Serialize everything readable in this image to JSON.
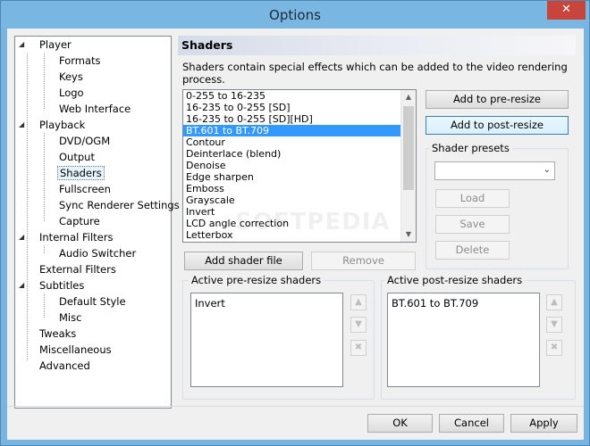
{
  "window": {
    "title": "Options",
    "close_glyph": "✕"
  },
  "tree": {
    "items": [
      {
        "label": "Player",
        "level": 0,
        "expandable": true
      },
      {
        "label": "Formats",
        "level": 1
      },
      {
        "label": "Keys",
        "level": 1
      },
      {
        "label": "Logo",
        "level": 1
      },
      {
        "label": "Web Interface",
        "level": 1
      },
      {
        "label": "Playback",
        "level": 0,
        "expandable": true
      },
      {
        "label": "DVD/OGM",
        "level": 1
      },
      {
        "label": "Output",
        "level": 1
      },
      {
        "label": "Shaders",
        "level": 1,
        "selected": true
      },
      {
        "label": "Fullscreen",
        "level": 1
      },
      {
        "label": "Sync Renderer Settings",
        "level": 1
      },
      {
        "label": "Capture",
        "level": 1
      },
      {
        "label": "Internal Filters",
        "level": 0,
        "expandable": true
      },
      {
        "label": "Audio Switcher",
        "level": 1
      },
      {
        "label": "External Filters",
        "level": 0
      },
      {
        "label": "Subtitles",
        "level": 0,
        "expandable": true
      },
      {
        "label": "Default Style",
        "level": 1
      },
      {
        "label": "Misc",
        "level": 1
      },
      {
        "label": "Tweaks",
        "level": 0
      },
      {
        "label": "Miscellaneous",
        "level": 0
      },
      {
        "label": "Advanced",
        "level": 0
      }
    ]
  },
  "page": {
    "title": "Shaders",
    "description": "Shaders contain special effects which can be added to the video rendering process."
  },
  "shader_list": {
    "items": [
      "0-255 to 16-235",
      "16-235 to 0-255 [SD]",
      "16-235 to 0-255 [SD][HD]",
      "BT.601 to BT.709",
      "Contour",
      "Deinterlace (blend)",
      "Denoise",
      "Edge sharpen",
      "Emboss",
      "Grayscale",
      "Invert",
      "LCD angle correction",
      "Letterbox"
    ],
    "selected_index": 3
  },
  "buttons": {
    "add_pre_resize": "Add to pre-resize",
    "add_post_resize": "Add to post-resize",
    "add_shader_file": "Add shader file",
    "remove": "Remove",
    "load": "Load",
    "save": "Save",
    "delete": "Delete",
    "ok": "OK",
    "cancel": "Cancel",
    "apply": "Apply"
  },
  "presets": {
    "label": "Shader presets",
    "selected_value": ""
  },
  "pre_resize": {
    "label": "Active pre-resize shaders",
    "items": [
      "Invert"
    ]
  },
  "post_resize": {
    "label": "Active post-resize shaders",
    "items": [
      "BT.601 to BT.709"
    ]
  },
  "watermark": "SOFTPEDIA",
  "colors": {
    "selection": "#3399ff",
    "titlebar": "#7ab6e2",
    "close": "#c7453b"
  }
}
